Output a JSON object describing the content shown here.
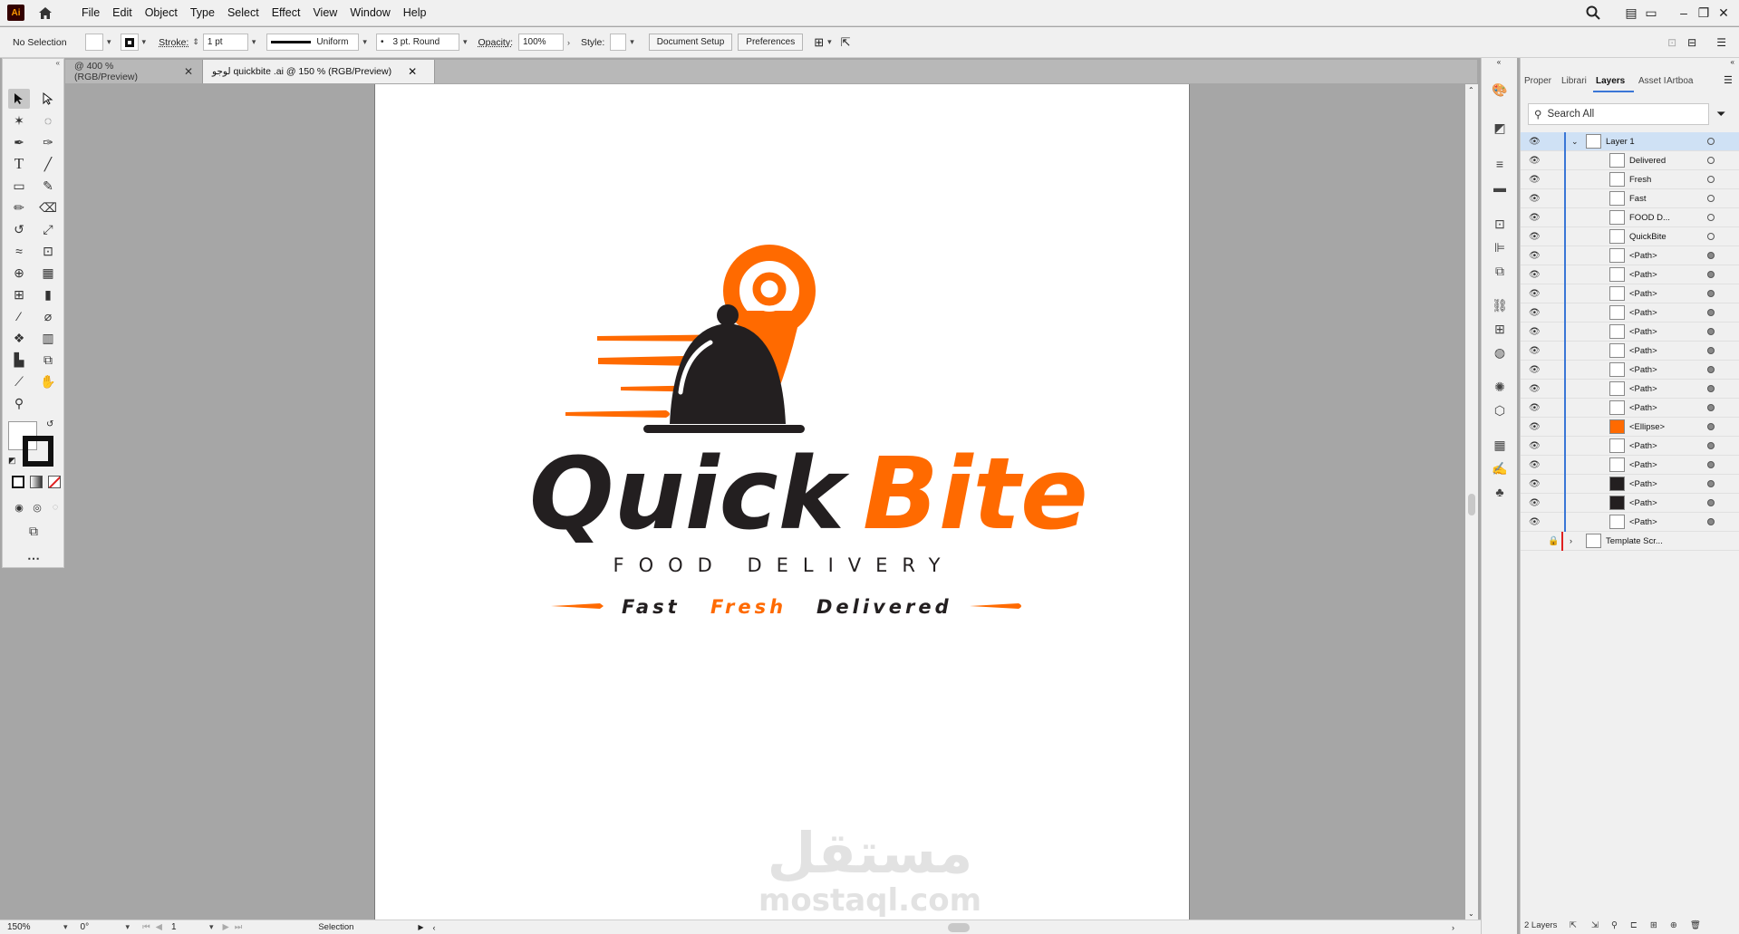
{
  "app": {
    "logo": "Ai",
    "menus": [
      "File",
      "Edit",
      "Object",
      "Type",
      "Select",
      "Effect",
      "View",
      "Window",
      "Help"
    ]
  },
  "control_bar": {
    "selection_label": "No Selection",
    "stroke_label": "Stroke:",
    "stroke_weight": "1 pt",
    "profile": "Uniform",
    "brush": "3 pt. Round",
    "opacity_label": "Opacity:",
    "opacity_value": "100%",
    "style_label": "Style:",
    "doc_setup": "Document Setup",
    "preferences": "Preferences"
  },
  "tabs": [
    {
      "label": "@ 400 % (RGB/Preview)",
      "active": false
    },
    {
      "label": "لوجو quickbite .ai @ 150 % (RGB/Preview)",
      "active": true
    }
  ],
  "artwork": {
    "brand_dark": "Quick",
    "brand_orange": "Bite",
    "subtitle": "FOOD DELIVERY",
    "tag_fast": "Fast",
    "tag_fresh": "Fresh",
    "tag_delivered": "Delivered",
    "watermark_ar": "مستقل",
    "watermark_en": "mostaql.com",
    "colors": {
      "orange": "#ff6a00",
      "dark": "#231f20"
    }
  },
  "status_bar": {
    "zoom": "150%",
    "rotation": "0°",
    "artboard_index": "1",
    "tool": "Selection"
  },
  "panel": {
    "tabs": [
      "Proper",
      "Librari",
      "Layers",
      "Asset I",
      "Artboa"
    ],
    "active_tab": "Layers",
    "search_placeholder": "Search All",
    "layers": [
      {
        "name": "Layer 1",
        "type": "layer"
      },
      {
        "name": "Delivered",
        "type": "item"
      },
      {
        "name": "Fresh",
        "type": "item"
      },
      {
        "name": "Fast",
        "type": "item"
      },
      {
        "name": "FOOD D...",
        "type": "item"
      },
      {
        "name": "QuickBite",
        "type": "item"
      },
      {
        "name": "<Path>",
        "type": "item"
      },
      {
        "name": "<Path>",
        "type": "item"
      },
      {
        "name": "<Path>",
        "type": "item"
      },
      {
        "name": "<Path>",
        "type": "item"
      },
      {
        "name": "<Path>",
        "type": "item"
      },
      {
        "name": "<Path>",
        "type": "item"
      },
      {
        "name": "<Path>",
        "type": "item"
      },
      {
        "name": "<Path>",
        "type": "item"
      },
      {
        "name": "<Path>",
        "type": "item"
      },
      {
        "name": "<Ellipse>",
        "type": "item"
      },
      {
        "name": "<Path>",
        "type": "item"
      },
      {
        "name": "<Path>",
        "type": "item"
      },
      {
        "name": "<Path>",
        "type": "item"
      },
      {
        "name": "<Path>",
        "type": "item"
      },
      {
        "name": "<Path>",
        "type": "item"
      },
      {
        "name": "Template Scr...",
        "type": "template"
      }
    ],
    "footer_count": "2 Layers"
  }
}
